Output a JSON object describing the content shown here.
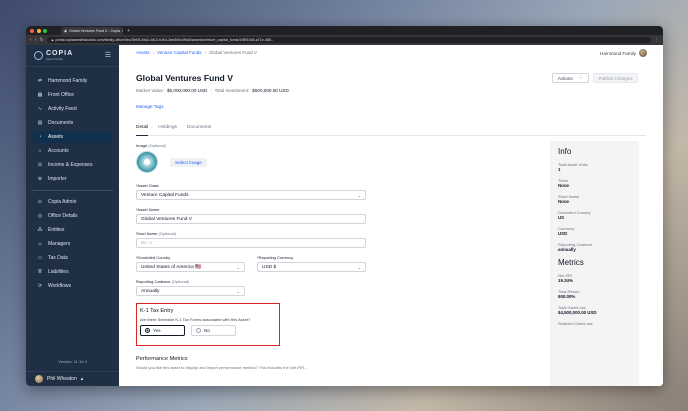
{
  "browser": {
    "tab_title": "Global Ventures Fund V - Copia",
    "url": "portal.copiawealthstudios.com/family-office/0ec29b05-6fa3-4d13-b3b4-3bb5b5c0f6d0/assets/venture_capital_funds/1f8910d0-a71e-485..."
  },
  "sidebar": {
    "logo_title": "COPIA",
    "logo_subtitle": "Aelon Portal",
    "items": [
      {
        "label": "Hammond Family",
        "icon": "swap-icon"
      },
      {
        "label": "Front Office",
        "icon": "building-icon"
      },
      {
        "label": "Activity Feed",
        "icon": "pulse-icon"
      },
      {
        "label": "Documents",
        "icon": "document-icon"
      },
      {
        "label": "Assets",
        "icon": "assets-icon"
      },
      {
        "label": "Accounts",
        "icon": "bank-icon"
      },
      {
        "label": "Income & Expenses",
        "icon": "scale-icon"
      },
      {
        "label": "Importer",
        "icon": "import-icon"
      }
    ],
    "admin_items": [
      {
        "label": "Copia Admin",
        "icon": "admin-icon"
      },
      {
        "label": "Office Details",
        "icon": "office-icon"
      },
      {
        "label": "Entities",
        "icon": "entities-icon"
      },
      {
        "label": "Managers",
        "icon": "managers-icon"
      },
      {
        "label": "Tax Data",
        "icon": "tax-icon"
      },
      {
        "label": "Liabilities",
        "icon": "liabilities-icon"
      },
      {
        "label": "Workflows",
        "icon": "workflow-icon"
      }
    ],
    "version": "Version: 11.14.4",
    "user_name": "Phil Wheaton"
  },
  "header": {
    "breadcrumbs": [
      "Assets",
      "Venture Capital Funds",
      "Global Ventures Fund V"
    ],
    "family": "Hammond Family",
    "title": "Global Ventures Fund V",
    "market_value_label": "Market Value:",
    "market_value": "$5,000,000.00 USD",
    "total_investment_label": "Total Investment:",
    "total_investment": "$500,000.00 USD",
    "actions_label": "Actions",
    "publish_label": "Publish Changes",
    "manage_tags": "Manage Tags"
  },
  "tabs": [
    "Detail",
    "Holdings",
    "Documents"
  ],
  "form": {
    "image_label": "Image",
    "image_optional": "(Optional)",
    "select_image": "Select Image",
    "asset_class_label": "*Asset Class",
    "asset_class_value": "Venture Capital Funds",
    "asset_name_label": "*Asset Name",
    "asset_name_value": "Global Ventures Fund V",
    "short_name_label": "Short Name",
    "short_name_optional": "(Optional)",
    "short_name_placeholder": "Btc V",
    "domiciled_label": "*Domiciled Country",
    "domiciled_value": "United States of America 🇺🇸",
    "currency_label": "*Reporting Currency",
    "currency_value": "USD $",
    "cadence_label": "Reporting Cadence",
    "cadence_optional": "(Optional)",
    "cadence_value": "Annually",
    "k1_title": "K-1 Tax Entry",
    "k1_question": "Are there Schedule K-1 Tax Forms associated with this Asset?",
    "yes_label": "Yes",
    "no_label": "No",
    "perf_title": "Performance Metrics",
    "perf_sub": "Would you like this asset to display and import performance metrics? This includes the Net IRR..."
  },
  "info": {
    "title": "Info",
    "fields": [
      {
        "k": "Total Asset Units",
        "v": "1"
      },
      {
        "k": "Ticker",
        "v": "None"
      },
      {
        "k": "Short Name",
        "v": "None"
      },
      {
        "k": "Domiciled Country",
        "v": "US"
      },
      {
        "k": "Currency",
        "v": "USD"
      },
      {
        "k": "Reporting Cadence",
        "v": "annually"
      }
    ],
    "metrics_title": "Metrics",
    "metrics": [
      {
        "k": "Net IRR",
        "v": "19.34%"
      },
      {
        "k": "Total Return",
        "v": "900.00%"
      },
      {
        "k": "Total Gain/Loss",
        "v": "$4,500,000.00 USD"
      },
      {
        "k": "Realized Gain/Loss",
        "v": ""
      }
    ]
  },
  "colors": {
    "sidebar": "#1f3044",
    "accent": "#2563eb",
    "highlight": "#dc2626"
  }
}
